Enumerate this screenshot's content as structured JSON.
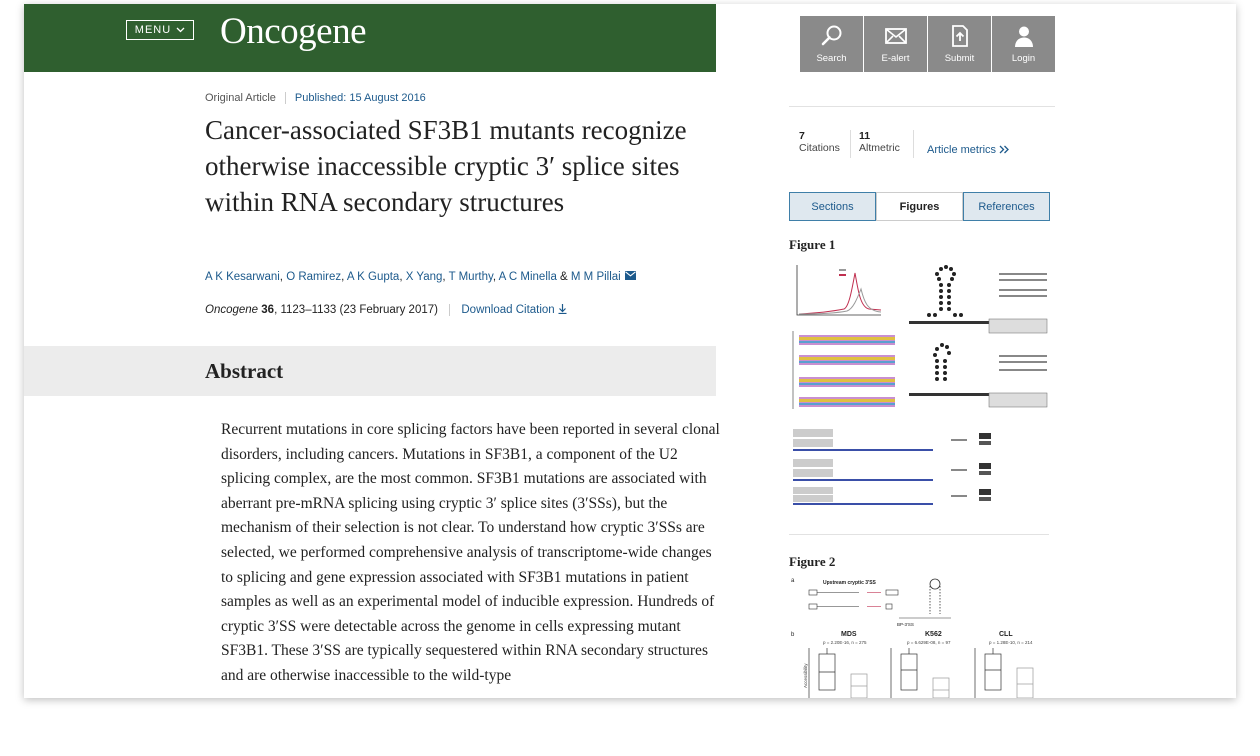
{
  "header": {
    "menu_label": "MENU",
    "logo": "Oncogene"
  },
  "toolbar": [
    {
      "label": "Search",
      "icon": "search-icon"
    },
    {
      "label": "E-alert",
      "icon": "envelope-icon"
    },
    {
      "label": "Submit",
      "icon": "upload-document-icon"
    },
    {
      "label": "Login",
      "icon": "user-icon"
    }
  ],
  "article": {
    "type": "Original Article",
    "published": "Published: 15 August 2016",
    "title": "Cancer-associated SF3B1 mutants recognize otherwise inaccessible cryptic 3′ splice sites within RNA secondary structures",
    "authors": [
      "A K Kesarwani",
      "O Ramirez",
      "A K Gupta",
      "X Yang",
      "T Murthy",
      "A C Minella",
      "M M Pillai"
    ],
    "author_sep": ", ",
    "author_and": " & ",
    "journal": "Oncogene",
    "volume": "36",
    "pages_date": ", 1123–1133 (23 February 2017)",
    "download_citation": "Download Citation"
  },
  "abstract": {
    "heading": "Abstract",
    "text": "Recurrent mutations in core splicing factors have been reported in several clonal disorders, including cancers. Mutations in SF3B1, a component of the U2 splicing complex, are the most common. SF3B1 mutations are associated with aberrant pre-mRNA splicing using cryptic 3′ splice sites (3′SSs), but the mechanism of their selection is not clear. To understand how cryptic 3′SSs are selected, we performed comprehensive analysis of transcriptome-wide changes to splicing and gene expression associated with SF3B1 mutations in patient samples as well as an experimental model of inducible expression. Hundreds of cryptic 3′SS were detectable across the genome in cells expressing mutant SF3B1. These 3′SS are typically sequestered within RNA secondary structures and are otherwise inaccessible to the wild-type"
  },
  "sidebar": {
    "citations_count": "7",
    "citations_label": "Citations",
    "altmetric_count": "11",
    "altmetric_label": "Altmetric",
    "article_metrics": "Article metrics",
    "tabs": [
      "Sections",
      "Figures",
      "References"
    ],
    "active_tab": "Figures",
    "figure1_label": "Figure 1",
    "figure2_label": "Figure 2",
    "fig2_panels": {
      "a": "a",
      "a_caption": "Upstream cryptic 3′SS",
      "bp": "BP-3′SS",
      "b": "b",
      "groups": [
        "MDS",
        "K562",
        "CLL"
      ],
      "pvalues": [
        "p = 2.20E-16, n = 275",
        "p = 6.629E-08, n = 97",
        "p = 1.28E-10, n = 214"
      ],
      "ylabel": "Accessibility"
    }
  },
  "colors": {
    "masthead": "#2f5f2f",
    "link": "#1d5a8c",
    "toolbar": "#8a8a8a",
    "abstract_band": "#ececec"
  }
}
